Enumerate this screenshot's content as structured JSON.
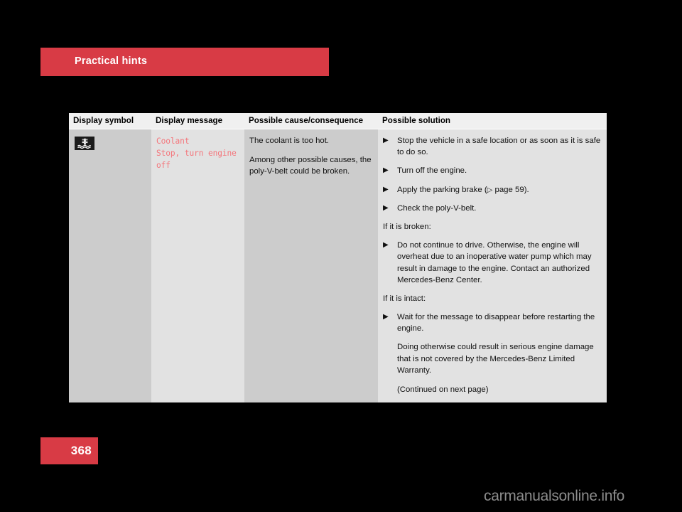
{
  "chapter": {
    "title": "Practical hints",
    "banner_color": "#d83b45"
  },
  "table": {
    "headers": {
      "symbol": "Display symbol",
      "message": "Display message",
      "cause": "Possible cause/consequence",
      "solution": "Possible solution"
    },
    "row": {
      "symbol_icon": "coolant-temperature-warning-icon",
      "display_message": "Coolant\nStop, turn engine\noff",
      "display_message_color": "#f4757b",
      "cause_paragraphs": [
        "The coolant is too hot.",
        "Among other possible causes, the poly-V-belt could be broken."
      ],
      "solution_blocks": [
        {
          "kind": "bullet",
          "marker": "▶",
          "text": "Stop the vehicle in a safe location or as soon as it is safe to do so."
        },
        {
          "kind": "bullet",
          "marker": "▶",
          "text": "Turn off the engine."
        },
        {
          "kind": "bullet-xref",
          "marker": "▶",
          "text_before": "Apply the parking brake (",
          "xref_arrow": "▷",
          "xref_text": " page 59",
          "text_after": ")."
        },
        {
          "kind": "bullet",
          "marker": "▶",
          "text": "Check the poly-V-belt."
        },
        {
          "kind": "subhead",
          "text": "If it is broken:"
        },
        {
          "kind": "bullet",
          "marker": "▶",
          "text": "Do not continue to drive. Otherwise, the engine will overheat due to an inoperative water pump which may result in damage to the engine. Contact an authorized Mercedes-Benz Center."
        },
        {
          "kind": "subhead",
          "text": "If it is intact:"
        },
        {
          "kind": "bullet",
          "marker": "▶",
          "text": "Wait for the message to disappear before restarting the engine."
        },
        {
          "kind": "indent",
          "text": "Doing otherwise could result in serious engine damage that is not covered by the Mercedes-Benz Limited Warranty."
        },
        {
          "kind": "indent",
          "text": "(Continued on next page)"
        }
      ]
    }
  },
  "footer": {
    "page_number": "368",
    "page_number_bg": "#d83b45",
    "watermark": "carmanualsonline.info"
  }
}
